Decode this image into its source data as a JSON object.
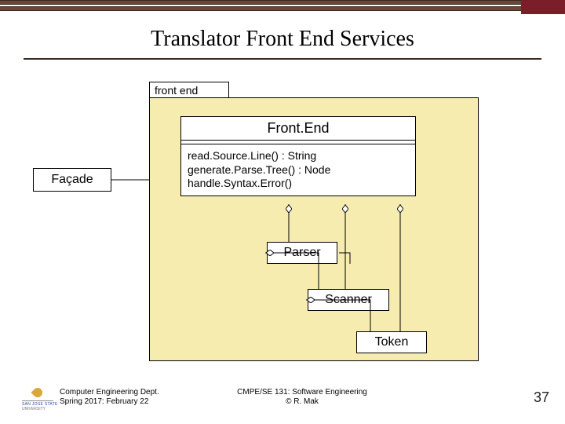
{
  "title": "Translator Front End Services",
  "package": {
    "label": "front end"
  },
  "facade": {
    "label": "Façade"
  },
  "mainClass": {
    "name": "Front.End",
    "method1": "read.Source.Line() : String",
    "method2": "generate.Parse.Tree() : Node",
    "method3": "handle.Syntax.Error()"
  },
  "sub": {
    "parser": "Parser",
    "scanner": "Scanner",
    "token": "Token"
  },
  "footer": {
    "left1": "Computer Engineering Dept.",
    "left2": "Spring 2017: February 22",
    "center1": "CMPE/SE 131: Software Engineering",
    "center2": "© R. Mak"
  },
  "pageNumber": "37",
  "logo": {
    "line1": "SAN JOSE STATE",
    "line2": "UNIVERSITY"
  }
}
